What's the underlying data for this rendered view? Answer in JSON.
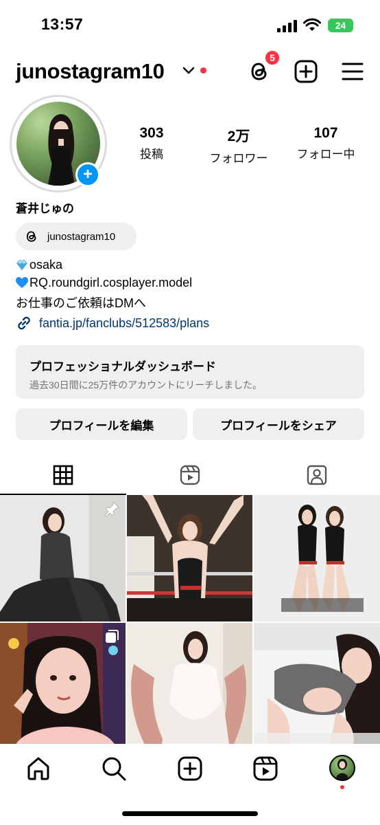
{
  "status_bar": {
    "time": "13:57",
    "battery": "24"
  },
  "header": {
    "username": "junostagram10",
    "threads_badge": "5"
  },
  "profile": {
    "stats": [
      {
        "value": "303",
        "label": "投稿"
      },
      {
        "value": "2万",
        "label": "フォロワー"
      },
      {
        "value": "107",
        "label": "フォロー中"
      }
    ],
    "display_name": "蒼井じゅの",
    "threads_handle": "junostagram10",
    "bio": [
      "osaka",
      "RQ.roundgirl.cosplayer.model",
      "お仕事のご依頼はDMへ"
    ],
    "link": "fantia.jp/fanclubs/512583/plans"
  },
  "dashboard": {
    "title": "プロフェッショナルダッシュボード",
    "subtitle": "過去30日間に25万件のアカウントにリーチしました。"
  },
  "buttons": {
    "edit": "プロフィールを編集",
    "share": "プロフィールをシェア"
  },
  "tabs": [
    {
      "icon": "grid-icon",
      "active": true
    },
    {
      "icon": "reels-icon",
      "active": false
    },
    {
      "icon": "tagged-icon",
      "active": false
    }
  ],
  "grid_overlays": [
    "pin-icon",
    "none",
    "none",
    "carousel-icon",
    "none",
    "none"
  ],
  "bottom_nav": [
    "home-icon",
    "search-icon",
    "create-icon",
    "reels-icon",
    "profile-avatar"
  ],
  "colors": {
    "accent": "#0095f6",
    "badge": "#ff3040",
    "link": "#00376b",
    "battery": "#34c759"
  }
}
